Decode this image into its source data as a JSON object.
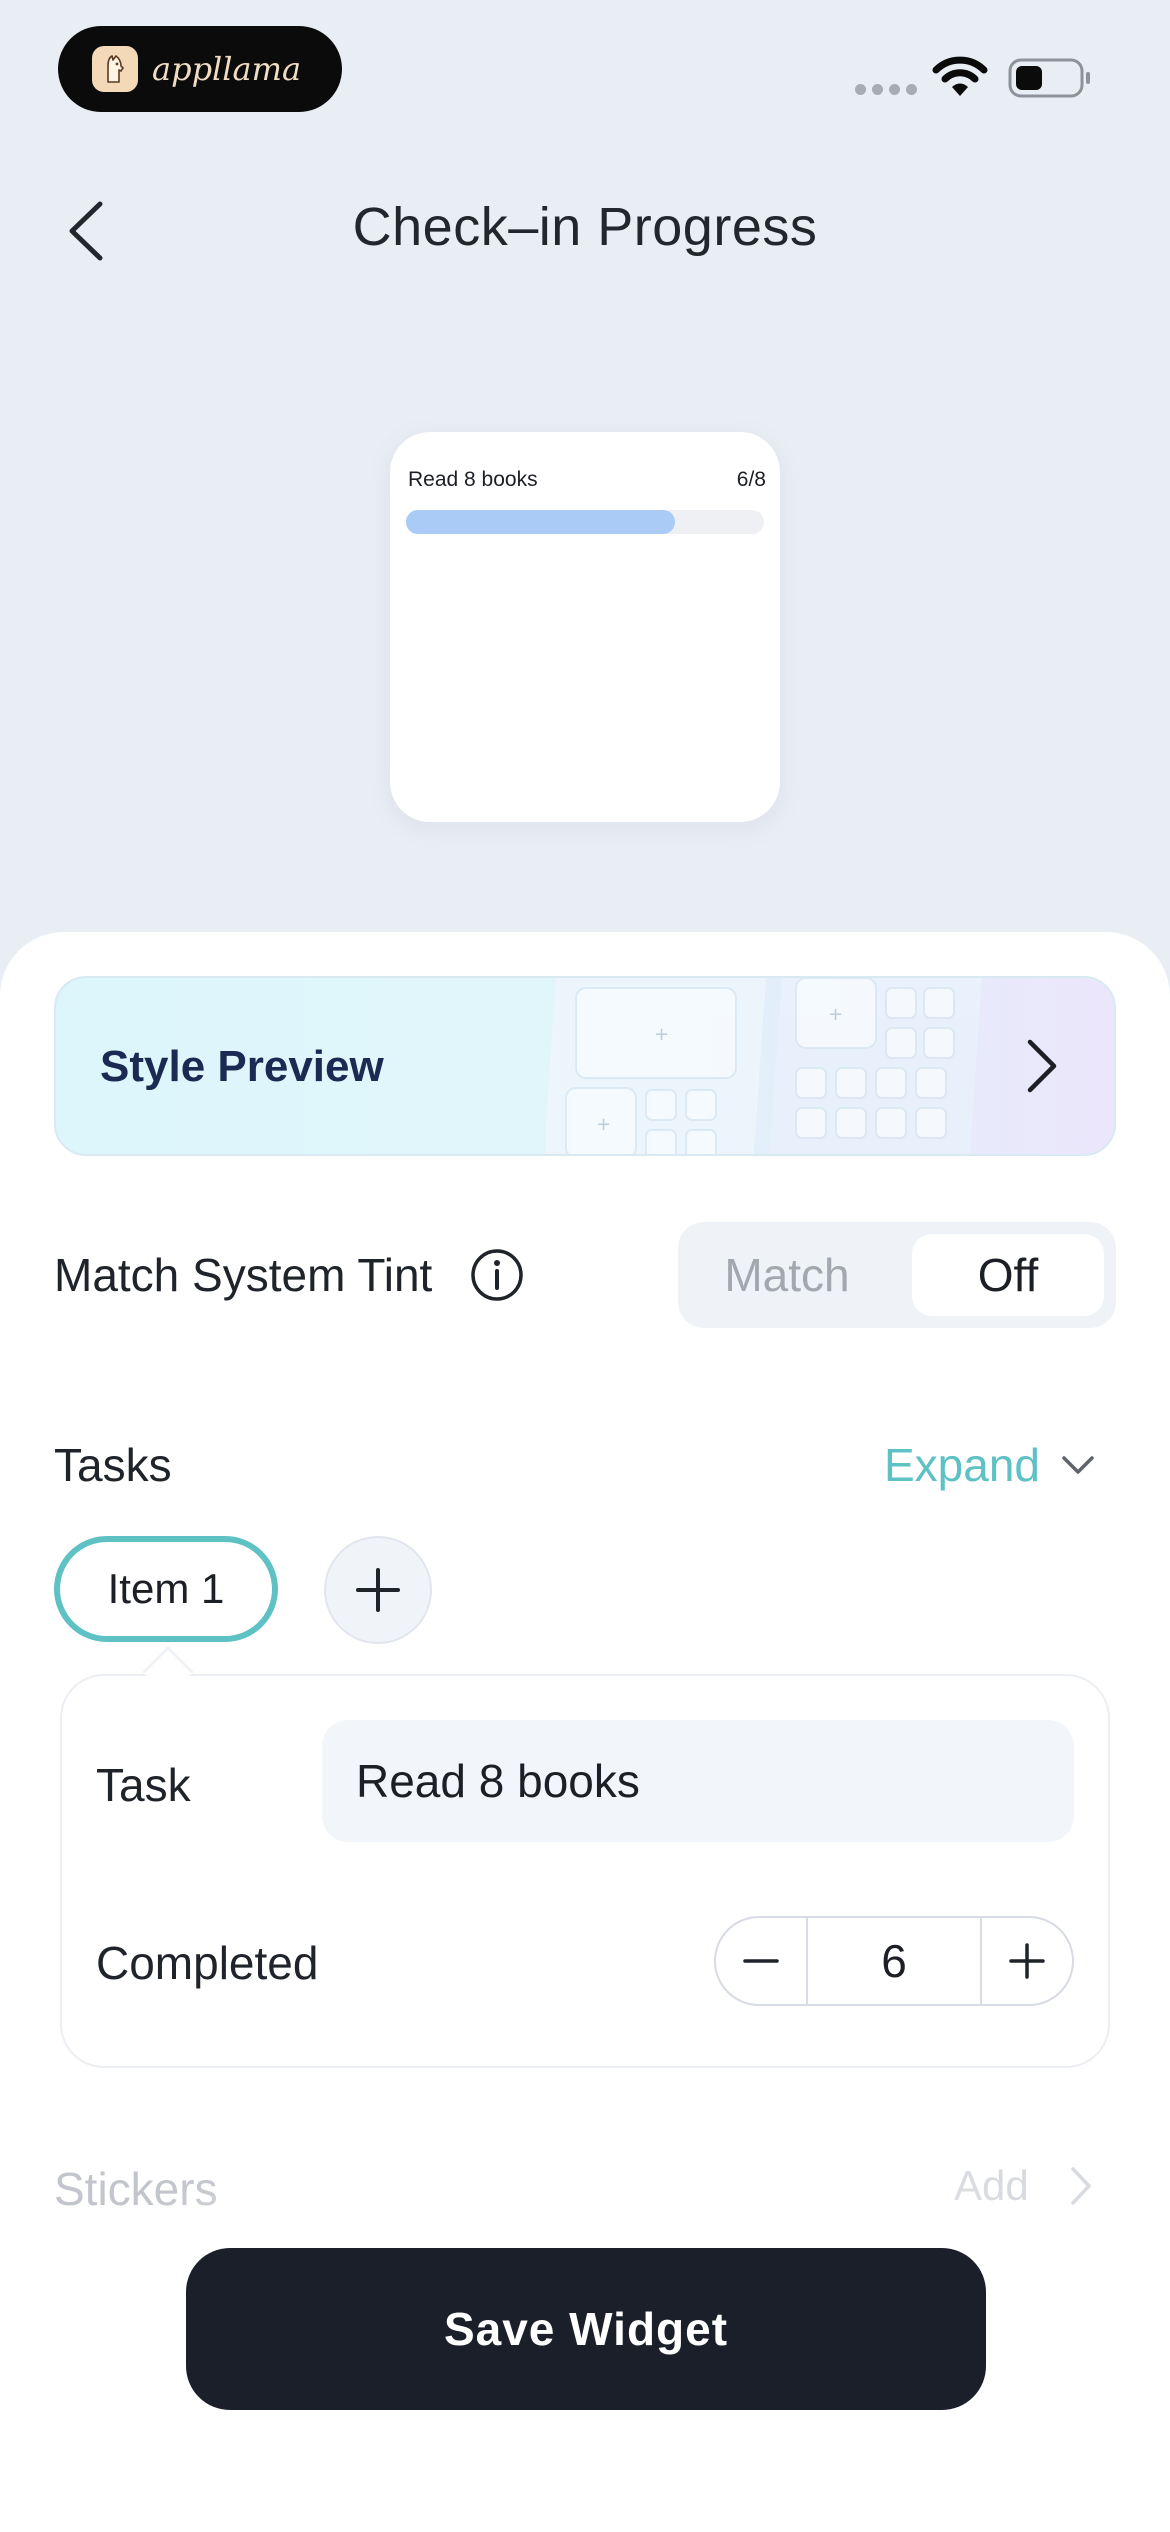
{
  "status_bar": {
    "brand": "appllama"
  },
  "header": {
    "title": "Check–in Progress"
  },
  "widget_preview": {
    "task": "Read 8 books",
    "progress_text": "6/8",
    "completed": 6,
    "total": 8,
    "bar_color": "#a9cbf6"
  },
  "style_preview": {
    "label": "Style Preview"
  },
  "tint": {
    "label": "Match System Tint",
    "options": [
      "Match",
      "Off"
    ],
    "selected": "Off"
  },
  "tasks": {
    "label": "Tasks",
    "expand_label": "Expand",
    "items": [
      "Item 1"
    ],
    "selected_item": "Item 1",
    "task_label": "Task",
    "task_value": "Read 8 books",
    "completed_label": "Completed",
    "completed_value": "6"
  },
  "stickers": {
    "label": "Stickers",
    "add_label": "Add"
  },
  "save_button": {
    "label": "Save Widget"
  },
  "colors": {
    "accent": "#5ec1c4",
    "primary_button": "#1b1f2a",
    "background": "#e9edf4"
  }
}
